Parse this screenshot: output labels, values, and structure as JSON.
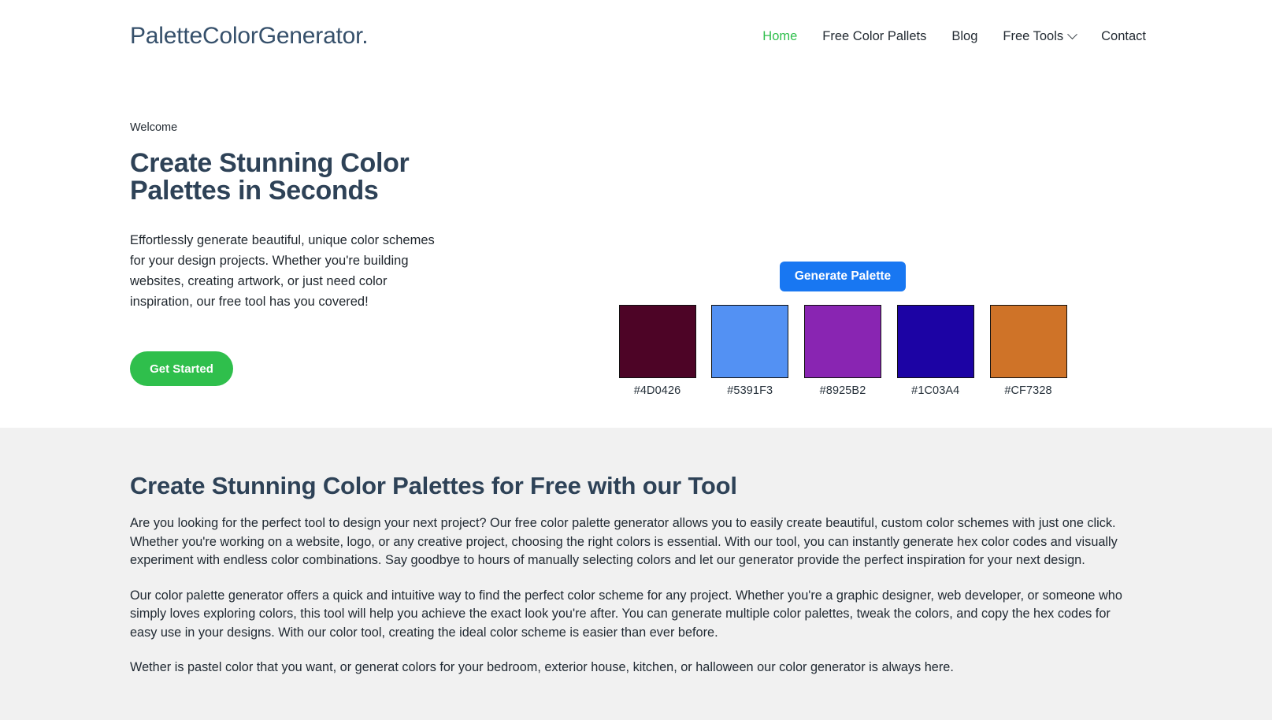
{
  "header": {
    "logo": "PaletteColorGenerator.",
    "nav": [
      {
        "label": "Home",
        "active": true,
        "has_chevron": false
      },
      {
        "label": "Free Color Pallets",
        "active": false,
        "has_chevron": false
      },
      {
        "label": "Blog",
        "active": false,
        "has_chevron": false
      },
      {
        "label": "Free Tools",
        "active": false,
        "has_chevron": true
      },
      {
        "label": "Contact",
        "active": false,
        "has_chevron": false
      }
    ]
  },
  "hero": {
    "eyebrow": "Welcome",
    "title": "Create Stunning Color Palettes in Seconds",
    "description": "Effortlessly generate beautiful, unique color schemes for your design projects. Whether you're building websites, creating artwork, or just need color inspiration, our free tool has you covered!",
    "cta_label": "Get Started",
    "generate_label": "Generate Palette",
    "palette": [
      {
        "hex": "#4D0426"
      },
      {
        "hex": "#5391F3"
      },
      {
        "hex": "#8925B2"
      },
      {
        "hex": "#1C03A4"
      },
      {
        "hex": "#CF7328"
      }
    ]
  },
  "info": {
    "title": "Create Stunning Color Palettes for Free with our Tool",
    "paragraphs": [
      "Are you looking for the perfect tool to design your next project? Our free color palette generator allows you to easily create beautiful, custom color schemes with just one click. Whether you're working on a website, logo, or any creative project, choosing the right colors is essential. With our tool, you can instantly generate hex color codes and visually experiment with endless color combinations. Say goodbye to hours of manually selecting colors and let our generator provide the perfect inspiration for your next design.",
      "Our color palette generator offers a quick and intuitive way to find the perfect color scheme for any project. Whether you're a graphic designer, web developer, or someone who simply loves exploring colors, this tool will help you achieve the exact look you're after. You can generate multiple color palettes, tweak the colors, and copy the hex codes for easy use in your designs. With our color tool, creating the ideal color scheme is easier than ever before.",
      "Wether is pastel color that you want, or generat colors for your bedroom, exterior house, kitchen, or halloween our color generator is always here."
    ]
  },
  "theme": {
    "accent_green": "#2fbf4c",
    "accent_blue": "#1877f2",
    "heading_color": "#2e4257",
    "section_bg": "#f1f1f1"
  }
}
